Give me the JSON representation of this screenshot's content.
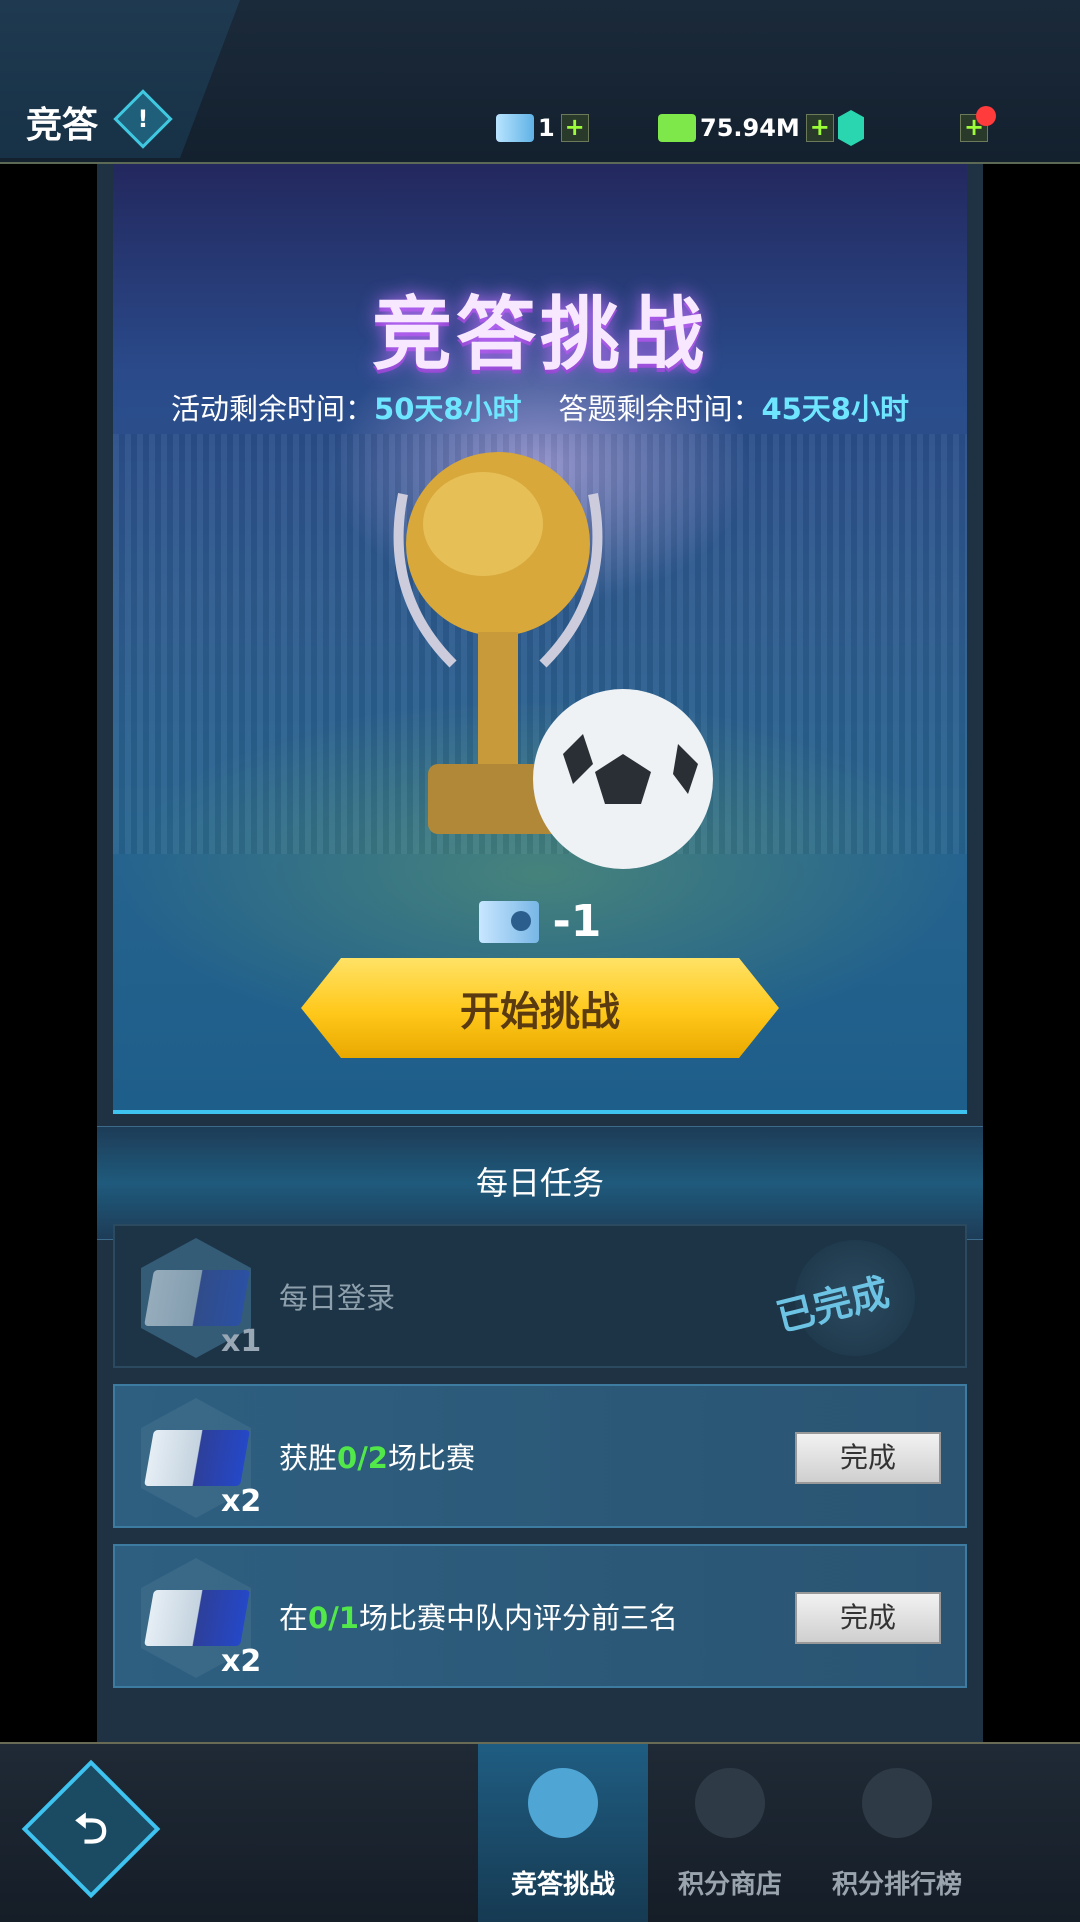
{
  "header": {
    "title": "竞答",
    "info_icon": "info-icon",
    "resources": [
      {
        "name": "ticket",
        "icon": "ticket-icon",
        "value": "1"
      },
      {
        "name": "cash",
        "icon": "cash-icon",
        "value": "75.94M"
      },
      {
        "name": "badge",
        "icon": "shield-badge-icon",
        "value": ""
      }
    ]
  },
  "hero": {
    "title": "竞答挑战",
    "activity_time_label": "活动剩余时间：",
    "activity_time_value": "50天8小时",
    "answer_time_label": "答题剩余时间：",
    "answer_time_value": "45天8小时",
    "cost": "-1",
    "start_button": "开始挑战"
  },
  "daily": {
    "section_title": "每日任务",
    "tasks": [
      {
        "text": "每日登录",
        "reward": "x1",
        "status": "已完成"
      },
      {
        "text_prefix": "获胜",
        "progress": "0/2",
        "text_suffix": "场比赛",
        "reward": "x2",
        "button": "完成"
      },
      {
        "text_prefix": "在",
        "progress": "0/1",
        "text_suffix": "场比赛中队内评分前三名",
        "reward": "x2",
        "button": "完成"
      }
    ]
  },
  "nav": {
    "back_icon": "back-icon",
    "items": [
      {
        "label": "竞答挑战",
        "active": true
      },
      {
        "label": "积分商店",
        "active": false
      },
      {
        "label": "积分排行榜",
        "active": false
      }
    ]
  },
  "colors": {
    "accent_cyan": "#6fe6ff",
    "progress_green": "#52e84a",
    "button_gold": "#ffc81a"
  }
}
